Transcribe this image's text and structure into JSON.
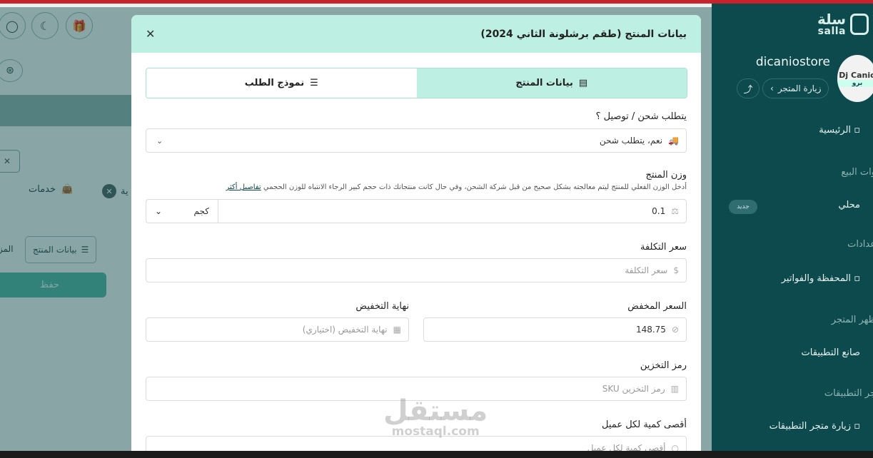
{
  "sidebar": {
    "logo_ar": "سلة",
    "logo_en": "salla",
    "store_name": "dicaniostore",
    "avatar_text": "Dj Canio",
    "avatar_tag": "برو",
    "visit_store": "زيارة المتجر",
    "items": {
      "home": "الرئيسية",
      "sales_channels": "وات البيع",
      "local": "محلي",
      "new_badge": "جديد",
      "settings": "عدادات",
      "wallet": "المحفظة والفواتير",
      "store_look": "ظهر المتجر",
      "app_maker": "صانع التطبيقات",
      "app_store": "جر التطبيقات",
      "visit_app_store": "زيارة متجر التطبيقات"
    }
  },
  "background": {
    "services": "خدمات",
    "cut_label": "ية",
    "product_data_tab": "بيانات المنتج",
    "cut_tab": "المز",
    "save": "حفظ"
  },
  "modal": {
    "title": "بيانات المنتج (طقم برشلونة الثاني 2024)",
    "tabs": [
      {
        "label": "بيانات المنتج",
        "active": true
      },
      {
        "label": "نموذج الطلب",
        "active": false
      }
    ],
    "shipping": {
      "label": "يتطلب شحن / توصيل ؟",
      "value": "نعم، يتطلب شحن"
    },
    "weight": {
      "label": "وزن المنتج",
      "help": "أدخل الوزن الفعلي للمنتج ليتم معالجته بشكل صحيح من قبل شركة الشحن، وفي حال كانت منتجاتك ذات حجم كبير الرجاء الانتباه للوزن الحجمي",
      "help_link": "تفاصيل أكثر",
      "value": "0.1",
      "unit": "كجم"
    },
    "cost": {
      "label": "سعر التكلفة",
      "placeholder": "سعر التكلفة"
    },
    "sale_price": {
      "label": "السعر المخفض",
      "value": "148.75"
    },
    "sale_end": {
      "label": "نهاية التخفيض",
      "placeholder": "نهاية التخفيض (اختياري)"
    },
    "sku": {
      "label": "رمز التخزين",
      "placeholder": "رمز التخزين SKU"
    },
    "max_qty": {
      "label": "أقصى كمية لكل عميل",
      "placeholder": "أقصى كمية لكل عميل"
    }
  },
  "watermark": {
    "ar": "مستقل",
    "en": "mostaql.com"
  }
}
